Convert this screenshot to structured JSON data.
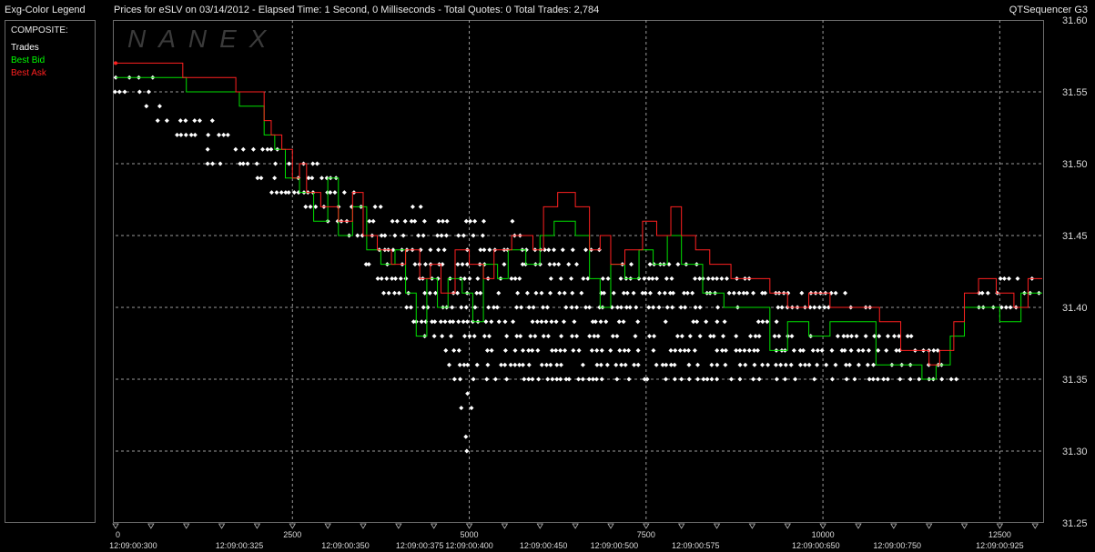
{
  "header": {
    "legend_title": "Exg-Color Legend",
    "chart_title": "Prices for  eSLV  on  03/14/2012  -  Elapsed Time: 1 Second, 0 Milliseconds  -  Total Quotes: 0  Total Trades: 2,784",
    "app_name": "QTSequencer G3"
  },
  "legend": {
    "heading": "COMPOSITE:",
    "items": [
      {
        "label": "Trades",
        "color": "#ffffff"
      },
      {
        "label": "Best Bid",
        "color": "#00ff00"
      },
      {
        "label": "Best Ask",
        "color": "#ff2020"
      }
    ]
  },
  "watermark": "NANEX",
  "colors": {
    "trade": "#ffffff",
    "bid": "#00e000",
    "ask": "#ff2020",
    "grid": "#9a9a9a"
  },
  "chart_data": {
    "type": "scatter",
    "title": "",
    "ylim": [
      31.25,
      31.6
    ],
    "xlim": [
      0,
      13100
    ],
    "y_ticks": [
      "31.25",
      "31.30",
      "31.35",
      "31.40",
      "31.45",
      "31.50",
      "31.55",
      "31.60"
    ],
    "x_ticks": [
      {
        "x": 0,
        "label": "0"
      },
      {
        "x": 2500,
        "label": "2500"
      },
      {
        "x": 5000,
        "label": "5000"
      },
      {
        "x": 7500,
        "label": "7500"
      },
      {
        "x": 10000,
        "label": "10000"
      },
      {
        "x": 12500,
        "label": "12500"
      }
    ],
    "time_labels": [
      {
        "x": 250,
        "label": "12:09:00:300"
      },
      {
        "x": 1750,
        "label": "12:09:00:325"
      },
      {
        "x": 3250,
        "label": "12:09:00:350"
      },
      {
        "x": 4300,
        "label": "12:09:00:375"
      },
      {
        "x": 5000,
        "label": "12:09:00:400"
      },
      {
        "x": 6050,
        "label": "12:09:00:450"
      },
      {
        "x": 7050,
        "label": "12:09:00:500"
      },
      {
        "x": 8200,
        "label": "12:09:00:575"
      },
      {
        "x": 9900,
        "label": "12:09:00:650"
      },
      {
        "x": 11050,
        "label": "12:09:00:750"
      },
      {
        "x": 12500,
        "label": "12:09:00:925"
      }
    ],
    "series": [
      {
        "name": "Best Ask",
        "points": [
          [
            0,
            31.57
          ],
          [
            950,
            31.57
          ],
          [
            950,
            31.56
          ],
          [
            1650,
            31.56
          ],
          [
            1700,
            31.55
          ],
          [
            2050,
            31.55
          ],
          [
            2100,
            31.53
          ],
          [
            2200,
            31.52
          ],
          [
            2350,
            31.51
          ],
          [
            2500,
            31.49
          ],
          [
            2600,
            31.5
          ],
          [
            2700,
            31.48
          ],
          [
            2900,
            31.47
          ],
          [
            3150,
            31.46
          ],
          [
            3350,
            31.48
          ],
          [
            3500,
            31.45
          ],
          [
            3700,
            31.44
          ],
          [
            3900,
            31.43
          ],
          [
            4100,
            31.44
          ],
          [
            4300,
            31.42
          ],
          [
            4450,
            31.43
          ],
          [
            4600,
            31.41
          ],
          [
            4800,
            31.44
          ],
          [
            5000,
            31.43
          ],
          [
            5200,
            31.42
          ],
          [
            5350,
            31.44
          ],
          [
            5600,
            31.45
          ],
          [
            5900,
            31.44
          ],
          [
            6050,
            31.47
          ],
          [
            6250,
            31.48
          ],
          [
            6500,
            31.47
          ],
          [
            6700,
            31.44
          ],
          [
            6850,
            31.45
          ],
          [
            7000,
            31.43
          ],
          [
            7200,
            31.44
          ],
          [
            7450,
            31.46
          ],
          [
            7650,
            31.45
          ],
          [
            7850,
            31.47
          ],
          [
            8000,
            31.45
          ],
          [
            8200,
            31.44
          ],
          [
            8400,
            31.43
          ],
          [
            8700,
            31.42
          ],
          [
            9000,
            31.42
          ],
          [
            9250,
            31.41
          ],
          [
            9500,
            31.4
          ],
          [
            9800,
            31.41
          ],
          [
            10100,
            31.4
          ],
          [
            10500,
            31.4
          ],
          [
            10800,
            31.39
          ],
          [
            11100,
            31.37
          ],
          [
            11500,
            31.36
          ],
          [
            11650,
            31.37
          ],
          [
            11850,
            31.39
          ],
          [
            12000,
            31.41
          ],
          [
            12200,
            31.42
          ],
          [
            12450,
            31.41
          ],
          [
            12700,
            31.4
          ],
          [
            12900,
            31.42
          ],
          [
            13100,
            31.42
          ]
        ]
      },
      {
        "name": "Best Bid",
        "points": [
          [
            0,
            31.56
          ],
          [
            900,
            31.56
          ],
          [
            1000,
            31.55
          ],
          [
            1700,
            31.55
          ],
          [
            1750,
            31.54
          ],
          [
            2100,
            31.52
          ],
          [
            2250,
            31.51
          ],
          [
            2400,
            31.49
          ],
          [
            2600,
            31.48
          ],
          [
            2800,
            31.46
          ],
          [
            3000,
            31.49
          ],
          [
            3150,
            31.45
          ],
          [
            3350,
            31.47
          ],
          [
            3550,
            31.44
          ],
          [
            3750,
            31.43
          ],
          [
            3950,
            31.44
          ],
          [
            4100,
            31.41
          ],
          [
            4250,
            31.38
          ],
          [
            4400,
            31.42
          ],
          [
            4550,
            31.4
          ],
          [
            4700,
            31.42
          ],
          [
            4900,
            31.41
          ],
          [
            5050,
            31.39
          ],
          [
            5200,
            31.43
          ],
          [
            5400,
            31.42
          ],
          [
            5550,
            31.44
          ],
          [
            5800,
            31.43
          ],
          [
            6000,
            31.45
          ],
          [
            6200,
            31.46
          ],
          [
            6500,
            31.45
          ],
          [
            6700,
            31.42
          ],
          [
            6850,
            31.4
          ],
          [
            7000,
            31.43
          ],
          [
            7200,
            31.42
          ],
          [
            7400,
            31.44
          ],
          [
            7600,
            31.43
          ],
          [
            7800,
            31.45
          ],
          [
            8000,
            31.43
          ],
          [
            8300,
            31.41
          ],
          [
            8600,
            31.4
          ],
          [
            8900,
            31.4
          ],
          [
            9250,
            31.37
          ],
          [
            9500,
            31.39
          ],
          [
            9800,
            31.38
          ],
          [
            10100,
            31.39
          ],
          [
            10450,
            31.39
          ],
          [
            10750,
            31.36
          ],
          [
            11100,
            31.36
          ],
          [
            11400,
            31.35
          ],
          [
            11600,
            31.36
          ],
          [
            11800,
            31.38
          ],
          [
            12000,
            31.4
          ],
          [
            12300,
            31.4
          ],
          [
            12500,
            31.39
          ],
          [
            12800,
            31.41
          ],
          [
            13100,
            31.41
          ]
        ]
      },
      {
        "name": "Trades",
        "bands": [
          {
            "x0": 0,
            "x1": 600,
            "y": 31.56
          },
          {
            "x0": 0,
            "x1": 500,
            "y": 31.55
          },
          {
            "x0": 300,
            "x1": 700,
            "y": 31.54
          },
          {
            "x0": 600,
            "x1": 1500,
            "y": 31.53
          },
          {
            "x0": 800,
            "x1": 1600,
            "y": 31.52
          },
          {
            "x0": 1300,
            "x1": 2300,
            "y": 31.51
          },
          {
            "x0": 1100,
            "x1": 2900,
            "y": 31.5
          },
          {
            "x0": 2000,
            "x1": 3200,
            "y": 31.49
          },
          {
            "x0": 2200,
            "x1": 3400,
            "y": 31.48
          },
          {
            "x0": 2500,
            "x1": 4500,
            "y": 31.47
          },
          {
            "x0": 3000,
            "x1": 5600,
            "y": 31.46
          },
          {
            "x0": 3300,
            "x1": 6300,
            "y": 31.45
          },
          {
            "x0": 3600,
            "x1": 6900,
            "y": 31.44
          },
          {
            "x0": 3400,
            "x1": 8300,
            "y": 31.43
          },
          {
            "x0": 3700,
            "x1": 9000,
            "y": 31.42
          },
          {
            "x0": 3800,
            "x1": 10300,
            "y": 31.41
          },
          {
            "x0": 4100,
            "x1": 10800,
            "y": 31.4
          },
          {
            "x0": 4200,
            "x1": 9400,
            "y": 31.39
          },
          {
            "x0": 4300,
            "x1": 11300,
            "y": 31.38
          },
          {
            "x0": 4600,
            "x1": 11700,
            "y": 31.37
          },
          {
            "x0": 4600,
            "x1": 11900,
            "y": 31.36
          },
          {
            "x0": 4800,
            "x1": 11900,
            "y": 31.35
          },
          {
            "x0": 4900,
            "x1": 5050,
            "y": 31.34
          },
          {
            "x0": 4900,
            "x1": 5050,
            "y": 31.33
          },
          {
            "x0": 4900,
            "x1": 5000,
            "y": 31.32
          },
          {
            "x0": 4950,
            "x1": 5000,
            "y": 31.31
          },
          {
            "x0": 4950,
            "x1": 5000,
            "y": 31.3
          },
          {
            "x0": 12200,
            "x1": 13000,
            "y": 31.4
          },
          {
            "x0": 12200,
            "x1": 13050,
            "y": 31.41
          },
          {
            "x0": 12500,
            "x1": 13000,
            "y": 31.42
          }
        ]
      }
    ]
  }
}
